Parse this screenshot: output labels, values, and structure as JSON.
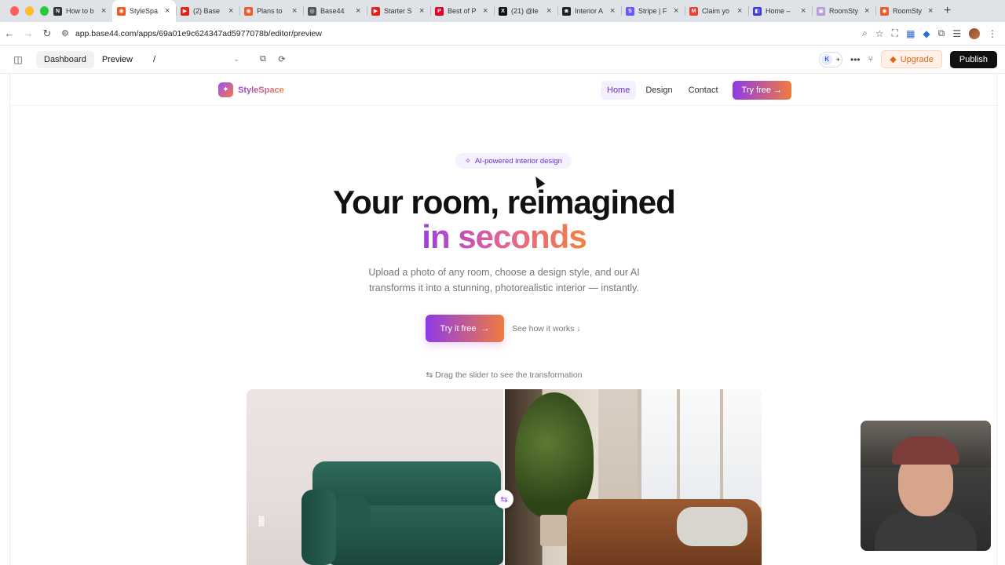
{
  "browser": {
    "tabs": [
      {
        "title": "How to b",
        "color": "#333333",
        "glyph": "N",
        "active": false
      },
      {
        "title": "StyleSpa",
        "color": "#f05a28",
        "glyph": "◉",
        "active": true
      },
      {
        "title": "(2) Base",
        "color": "#e62117",
        "glyph": "▶",
        "active": false
      },
      {
        "title": "Plans to",
        "color": "#f05a28",
        "glyph": "◉",
        "active": false
      },
      {
        "title": "Base44",
        "color": "#555555",
        "glyph": "◎",
        "active": false
      },
      {
        "title": "Starter S",
        "color": "#e62117",
        "glyph": "▶",
        "active": false
      },
      {
        "title": "Best of P",
        "color": "#e60023",
        "glyph": "P",
        "active": false
      },
      {
        "title": "(21) @le",
        "color": "#111111",
        "glyph": "X",
        "active": false
      },
      {
        "title": "Interior A",
        "color": "#222222",
        "glyph": "◙",
        "active": false
      },
      {
        "title": "Stripe | F",
        "color": "#635bff",
        "glyph": "S",
        "active": false
      },
      {
        "title": "Claim yo",
        "color": "#ea4335",
        "glyph": "M",
        "active": false
      },
      {
        "title": "Home –",
        "color": "#3b3bd6",
        "glyph": "◧",
        "active": false
      },
      {
        "title": "RoomSty",
        "color": "#b79ad8",
        "glyph": "▣",
        "active": false
      },
      {
        "title": "RoomSty",
        "color": "#f05a28",
        "glyph": "◉",
        "active": false
      }
    ],
    "url": "app.base44.com/apps/69a01e9c624347ad5977078b/editor/preview"
  },
  "editor": {
    "dashboard_label": "Dashboard",
    "preview_label": "Preview",
    "route_value": "/",
    "avatar_initial": "K",
    "upgrade_label": "Upgrade",
    "publish_label": "Publish"
  },
  "site": {
    "brand": "StyleSpace",
    "nav": {
      "home": "Home",
      "design": "Design",
      "contact": "Contact",
      "cta": "Try free →"
    },
    "badge": "AI-powered interior design",
    "title_line1": "Your room, reimagined",
    "title_line2": "in seconds",
    "subtitle": "Upload a photo of any room, choose a design style, and our AI transforms it into a stunning, photorealistic interior — instantly.",
    "cta_primary": "Try it free",
    "cta_secondary": "See how it works ↓",
    "drag_hint": "Drag the slider to see the transformation"
  },
  "colors": {
    "accent_purple": "#8e3ae8",
    "accent_orange": "#f07b3f",
    "publish_bg": "#111111",
    "upgrade_text": "#e0661b"
  }
}
